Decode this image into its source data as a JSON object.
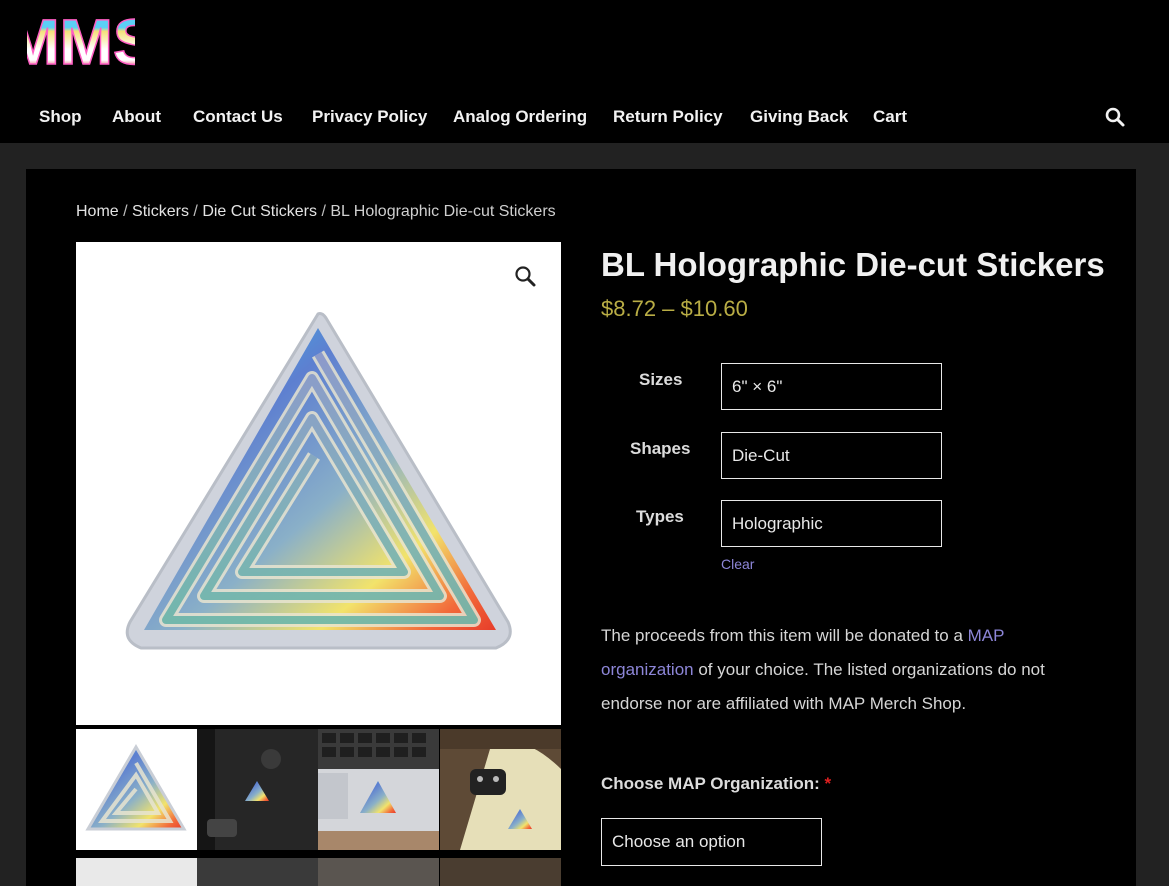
{
  "header": {
    "logo_text": "MMS",
    "nav": [
      "Shop",
      "About",
      "Contact Us",
      "Privacy Policy",
      "Analog Ordering",
      "Return Policy",
      "Giving Back",
      "Cart"
    ]
  },
  "breadcrumb": {
    "items": [
      "Home",
      "Stickers",
      "Die Cut Stickers",
      "BL Holographic Die-cut Stickers"
    ],
    "separator": "/"
  },
  "product": {
    "title": "BL Holographic Die-cut Stickers",
    "price_range": "$8.72 – $10.60",
    "variations": [
      {
        "label": "Sizes",
        "value": "6\" × 6\""
      },
      {
        "label": "Shapes",
        "value": "Die-Cut"
      },
      {
        "label": "Types",
        "value": "Holographic"
      }
    ],
    "clear_label": "Clear",
    "description": {
      "before": "The proceeds from this item will be donated to a ",
      "link": "MAP organization",
      "after": " of your choice. The listed organizations do not endorse nor are affiliated with MAP Merch Shop."
    },
    "org_label": "Choose MAP Organization:",
    "required_mark": "*",
    "org_placeholder": "Choose an option"
  },
  "colors": {
    "price": "#b9ad45",
    "link": "#8d86d8",
    "required": "#e02020"
  },
  "icons": [
    "search-icon",
    "zoom-icon"
  ]
}
